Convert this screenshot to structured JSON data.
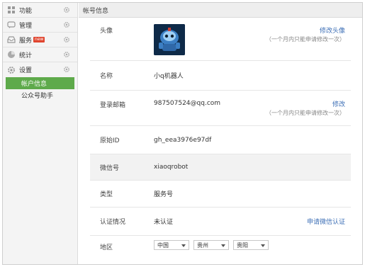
{
  "sidebar": {
    "items": [
      {
        "label": "功能",
        "icon": "grid-icon"
      },
      {
        "label": "管理",
        "icon": "chat-icon"
      },
      {
        "label": "服务",
        "icon": "tray-icon",
        "badge": "new"
      },
      {
        "label": "统计",
        "icon": "pie-icon"
      },
      {
        "label": "设置",
        "icon": "gear-icon"
      }
    ],
    "subitems": [
      {
        "label": "帐户信息",
        "active": true
      },
      {
        "label": "公众号助手",
        "active": false
      }
    ]
  },
  "main": {
    "header": "帐号信息",
    "rows": {
      "avatar": {
        "label": "头像",
        "action": "修改头像",
        "hint": "（一个月内只能申请修改一次）"
      },
      "name": {
        "label": "名称",
        "value": "小q机器人"
      },
      "email": {
        "label": "登录邮箱",
        "value": "987507524@qq.com",
        "action": "修改",
        "hint": "（一个月内只能申请修改一次）"
      },
      "original_id": {
        "label": "原始ID",
        "value": "gh_eea3976e97df"
      },
      "wechat_id": {
        "label": "微信号",
        "value": "xiaoqrobot"
      },
      "type": {
        "label": "类型",
        "value": "服务号"
      },
      "verification": {
        "label": "认证情况",
        "value": "未认证",
        "action": "申请微信认证"
      },
      "region": {
        "label": "地区",
        "country": "中国",
        "province": "贵州",
        "city": "贵阳"
      }
    }
  },
  "colors": {
    "accent": "#5eaa4b",
    "link": "#3d6fb6",
    "badge": "#e0452f"
  }
}
